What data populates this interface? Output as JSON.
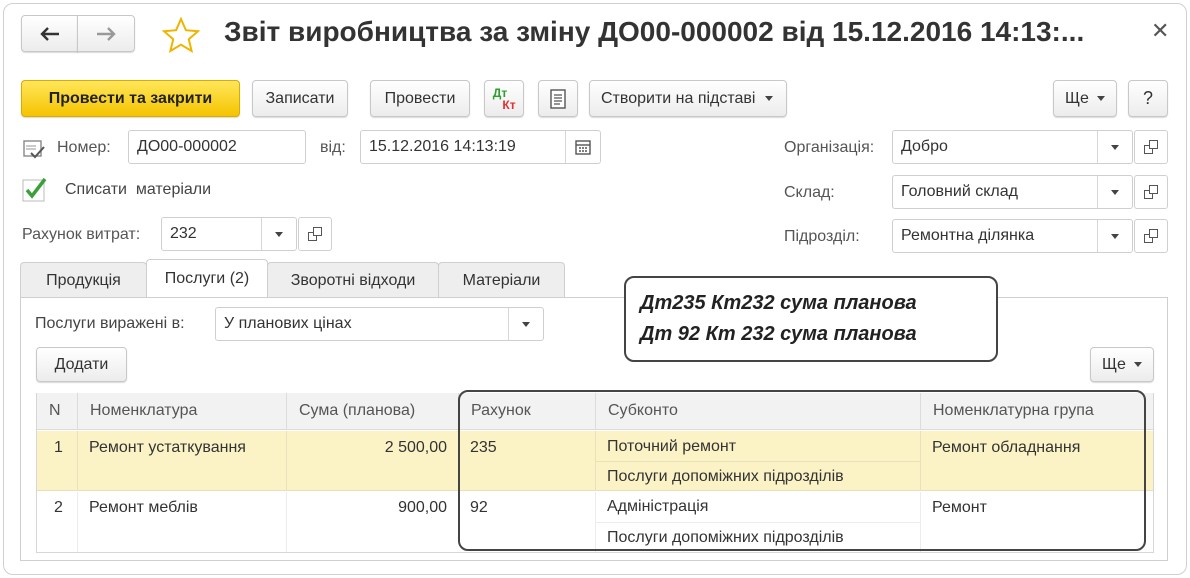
{
  "title": "Звіт виробництва за зміну ДО00-000002 від 15.12.2016 14:13:...",
  "toolbar": {
    "post_close": "Провести та закрити",
    "save": "Записати",
    "post": "Провести",
    "dt_top": "Дт",
    "dt_bottom": "Кт",
    "create_based": "Створити на підставі",
    "more": "Ще",
    "help": "?"
  },
  "header": {
    "number_label": "Номер:",
    "number_value": "ДО00-000002",
    "date_label": "від:",
    "date_value": "15.12.2016 14:13:19",
    "writeoff_label": "Списати  матеріали",
    "cost_account_label": "Рахунок витрат:",
    "cost_account_value": "232",
    "org_label": "Організація:",
    "org_value": "Добро",
    "warehouse_label": "Склад:",
    "warehouse_value": "Головний склад",
    "division_label": "Підрозділ:",
    "division_value": "Ремонтна ділянка"
  },
  "tabs": [
    {
      "label": "Продукція"
    },
    {
      "label": "Послуги (2)"
    },
    {
      "label": "Зворотні відходи"
    },
    {
      "label": "Матеріали"
    }
  ],
  "services": {
    "expressed_label": "Послуги виражені в:",
    "expressed_value": "У планових цінах",
    "add": "Додати",
    "more": "Ще"
  },
  "table": {
    "columns": [
      "N",
      "Номенклатура",
      "Сума (планова)",
      "Рахунок",
      "Субконто",
      "Номенклатурна група"
    ],
    "rows": [
      {
        "n": "1",
        "item": "Ремонт устаткування",
        "sum": "2 500,00",
        "account": "235",
        "sub1": "Поточний ремонт",
        "sub2": "Послуги допоміжних підрозділів",
        "group": "Ремонт обладнання"
      },
      {
        "n": "2",
        "item": "Ремонт меблів",
        "sum": "900,00",
        "account": "92",
        "sub1": "Адміністрація",
        "sub2": "Послуги допоміжних підрозділів",
        "group": "Ремонт"
      }
    ]
  },
  "annotation": {
    "line1": "Дт235 Кт232 сума планова",
    "line2": "Дт 92 Кт 232 сума планова"
  },
  "colors": {
    "primary_button": "#f5c400",
    "selected_row": "#fbf3c6",
    "checkbox": "#3aa03a",
    "star": "#f0b400",
    "dt_green": "#2e9e2e",
    "kt_red": "#e03030"
  }
}
